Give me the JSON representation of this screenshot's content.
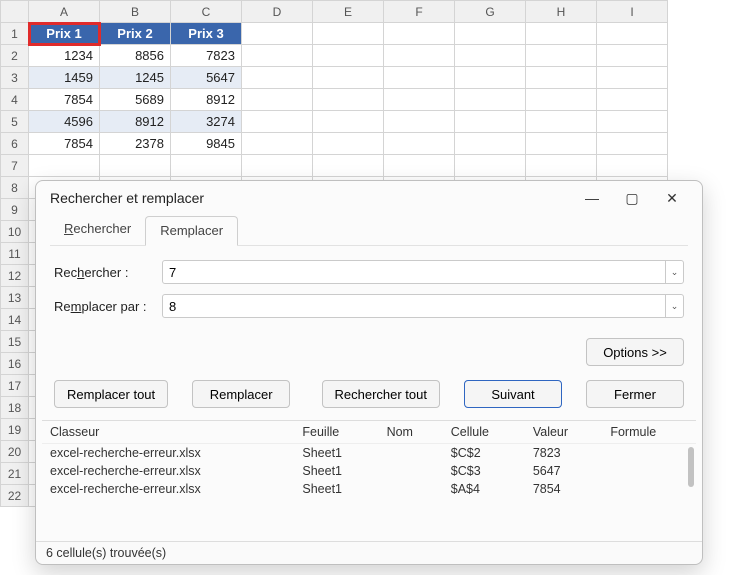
{
  "sheet": {
    "columns": [
      "A",
      "B",
      "C",
      "D",
      "E",
      "F",
      "G",
      "H",
      "I"
    ],
    "rows": [
      "1",
      "2",
      "3",
      "4",
      "5",
      "6",
      "7",
      "8",
      "9",
      "10",
      "11",
      "12",
      "13",
      "14",
      "15",
      "16",
      "17",
      "18",
      "19",
      "20",
      "21",
      "22"
    ],
    "headers": {
      "a": "Prix 1",
      "b": "Prix 2",
      "c": "Prix 3"
    },
    "data": [
      {
        "a": "1234",
        "b": "8856",
        "c": "7823"
      },
      {
        "a": "1459",
        "b": "1245",
        "c": "5647"
      },
      {
        "a": "7854",
        "b": "5689",
        "c": "8912"
      },
      {
        "a": "4596",
        "b": "8912",
        "c": "3274"
      },
      {
        "a": "7854",
        "b": "2378",
        "c": "9845"
      }
    ]
  },
  "dialog": {
    "title": "Rechercher et remplacer",
    "tabs": {
      "search": "Rechercher",
      "replace": "Remplacer"
    },
    "labels": {
      "search": "Rechercher :",
      "replace": "Remplacer par :"
    },
    "values": {
      "search": "7",
      "replace": "8"
    },
    "buttons": {
      "options": "Options >>",
      "replace_all": "Remplacer tout",
      "replace": "Remplacer",
      "find_all": "Rechercher tout",
      "next": "Suivant",
      "close": "Fermer"
    },
    "results": {
      "headers": {
        "workbook": "Classeur",
        "sheet": "Feuille",
        "name": "Nom",
        "cell": "Cellule",
        "value": "Valeur",
        "formula": "Formule"
      },
      "rows": [
        {
          "workbook": "excel-recherche-erreur.xlsx",
          "sheet": "Sheet1",
          "name": "",
          "cell": "$C$2",
          "value": "7823",
          "formula": ""
        },
        {
          "workbook": "excel-recherche-erreur.xlsx",
          "sheet": "Sheet1",
          "name": "",
          "cell": "$C$3",
          "value": "5647",
          "formula": ""
        },
        {
          "workbook": "excel-recherche-erreur.xlsx",
          "sheet": "Sheet1",
          "name": "",
          "cell": "$A$4",
          "value": "7854",
          "formula": ""
        }
      ]
    },
    "status": "6 cellule(s) trouvée(s)"
  }
}
